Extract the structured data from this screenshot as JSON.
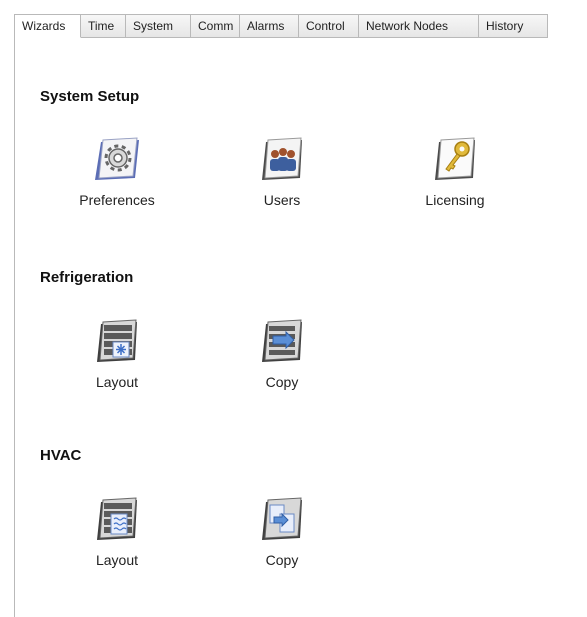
{
  "tabs": [
    {
      "label": "Wizards",
      "active": true
    },
    {
      "label": "Time"
    },
    {
      "label": "System"
    },
    {
      "label": "Comm"
    },
    {
      "label": "Alarms"
    },
    {
      "label": "Control"
    },
    {
      "label": "Network Nodes"
    },
    {
      "label": "History"
    }
  ],
  "sections": [
    {
      "title": "System Setup",
      "items": [
        {
          "label": "Preferences",
          "icon": "gear-icon"
        },
        {
          "label": "Users",
          "icon": "users-icon"
        },
        {
          "label": "Licensing",
          "icon": "key-icon"
        }
      ]
    },
    {
      "title": "Refrigeration",
      "items": [
        {
          "label": "Layout",
          "icon": "refrigeration-layout-icon"
        },
        {
          "label": "Copy",
          "icon": "refrigeration-copy-icon"
        }
      ]
    },
    {
      "title": "HVAC",
      "items": [
        {
          "label": "Layout",
          "icon": "hvac-layout-icon"
        },
        {
          "label": "Copy",
          "icon": "hvac-copy-icon"
        }
      ]
    }
  ],
  "colors": {
    "tab_border": "#b9b9b9",
    "accent_blue": "#4a78b8",
    "key_gold": "#e0b93a"
  }
}
